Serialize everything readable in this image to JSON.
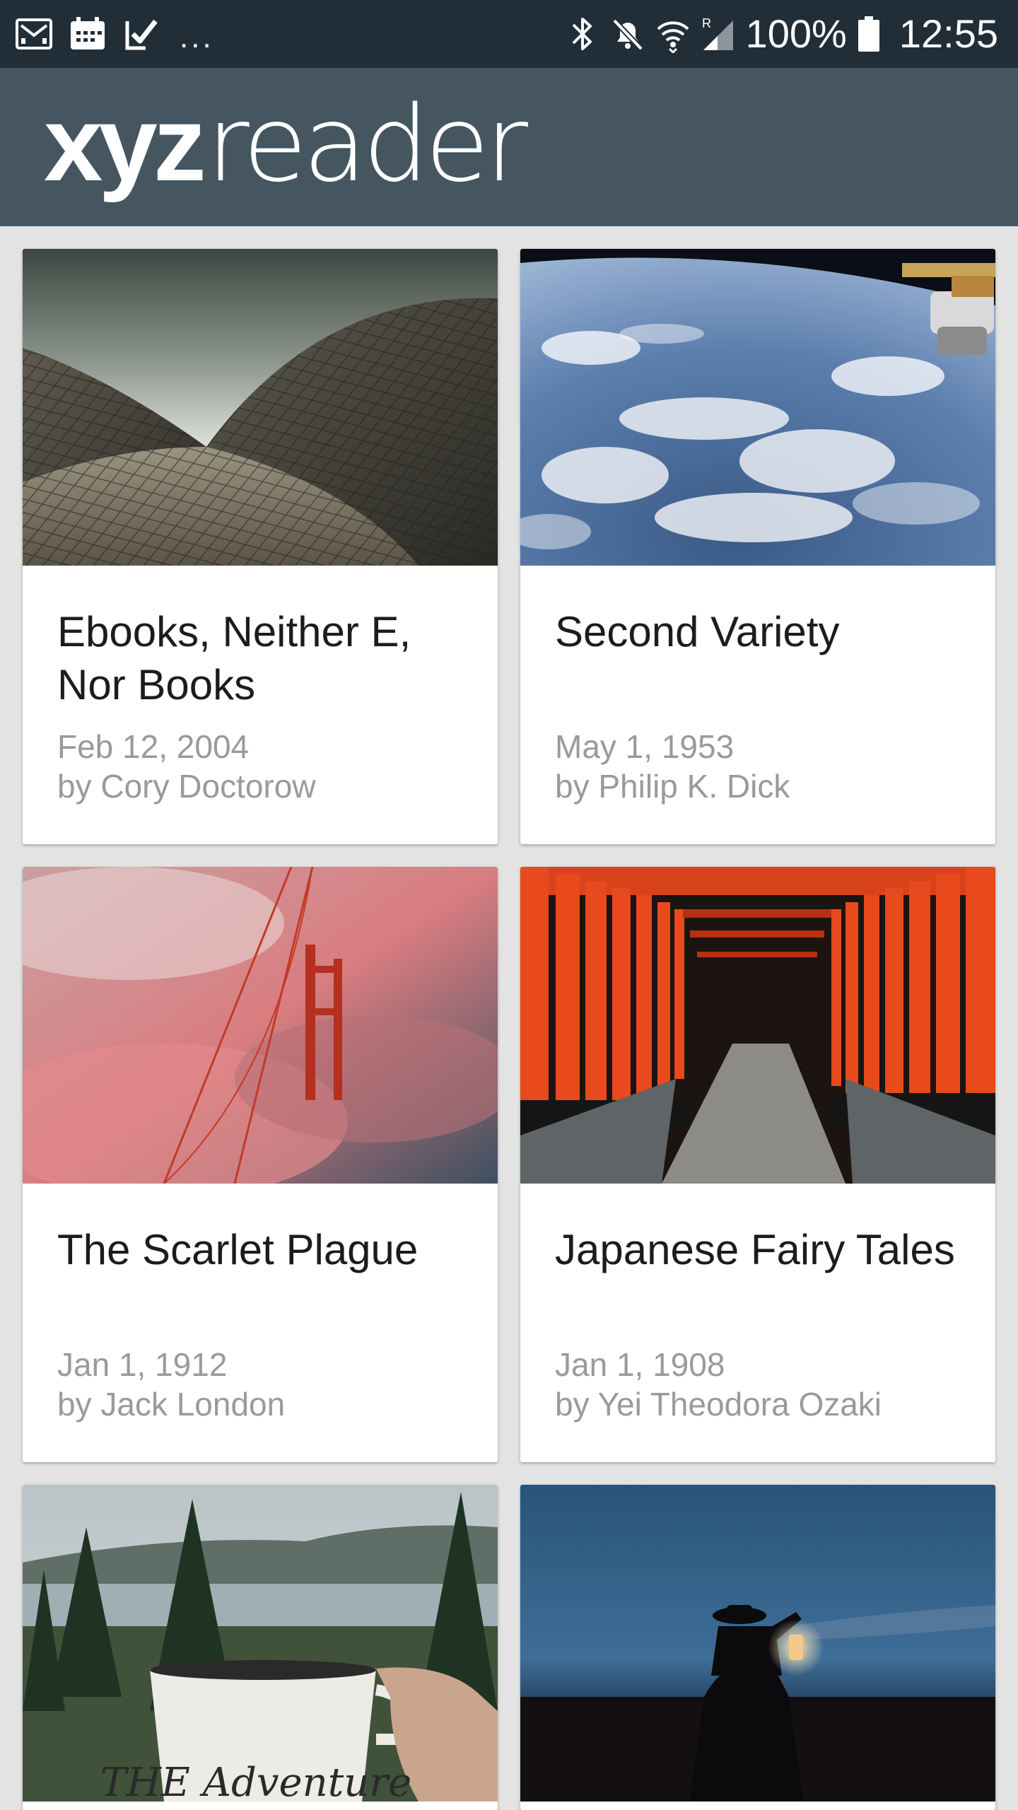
{
  "status_bar": {
    "left_icons": [
      "gmail-icon",
      "calendar-icon",
      "tasks-check-icon"
    ],
    "overflow_dots": "...",
    "right_icons": [
      "bluetooth-icon",
      "mute-icon",
      "wifi-icon",
      "signal-icon",
      "battery-icon"
    ],
    "battery": "100%",
    "time": "12:55",
    "colors": {
      "background": "#212e38",
      "foreground": "#ffffff"
    }
  },
  "app_bar": {
    "logo_bold": "xyz",
    "logo_light": "reader",
    "color": "#455661"
  },
  "articles": [
    {
      "title": "Ebooks, Neither E, Nor Books",
      "date": "Feb 12, 2004",
      "author": "by Cory Doctorow",
      "image": "opera-house-roof-photo"
    },
    {
      "title": "Second Variety",
      "date": "May 1, 1953",
      "author": "by Philip K. Dick",
      "image": "earth-from-space-photo"
    },
    {
      "title": "The Scarlet Plague",
      "date": "Jan 1, 1912",
      "author": "by Jack London",
      "image": "golden-gate-bridge-fog-photo"
    },
    {
      "title": "Japanese Fairy Tales",
      "date": "Jan 1, 1908",
      "author": "by Yei Theodora Ozaki",
      "image": "torii-gates-path-photo"
    },
    {
      "title": "",
      "date": "",
      "author": "",
      "image": "lake-forest-mug-photo",
      "mug_text": "THE Adventure"
    },
    {
      "title": "",
      "date": "",
      "author": "",
      "image": "night-rider-lantern-photo"
    }
  ]
}
